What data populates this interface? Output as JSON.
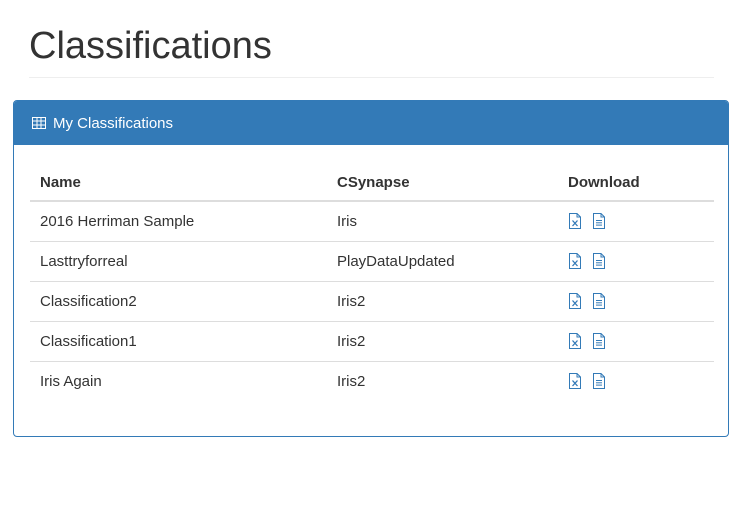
{
  "page": {
    "title": "Classifications"
  },
  "panel": {
    "heading": "My Classifications",
    "icon": "table-icon"
  },
  "table": {
    "headers": {
      "name": "Name",
      "synapse": "CSynapse",
      "download": "Download"
    },
    "rows": [
      {
        "name": "2016 Herriman Sample",
        "synapse": "Iris"
      },
      {
        "name": "Lasttryforreal",
        "synapse": "PlayDataUpdated"
      },
      {
        "name": "Classification2",
        "synapse": "Iris2"
      },
      {
        "name": "Classification1",
        "synapse": "Iris2"
      },
      {
        "name": "Iris Again",
        "synapse": "Iris2"
      }
    ],
    "download_icons": [
      "excel-file-icon",
      "text-file-icon"
    ]
  },
  "colors": {
    "primary": "#337ab7",
    "text": "#333333",
    "border": "#dddddd"
  }
}
